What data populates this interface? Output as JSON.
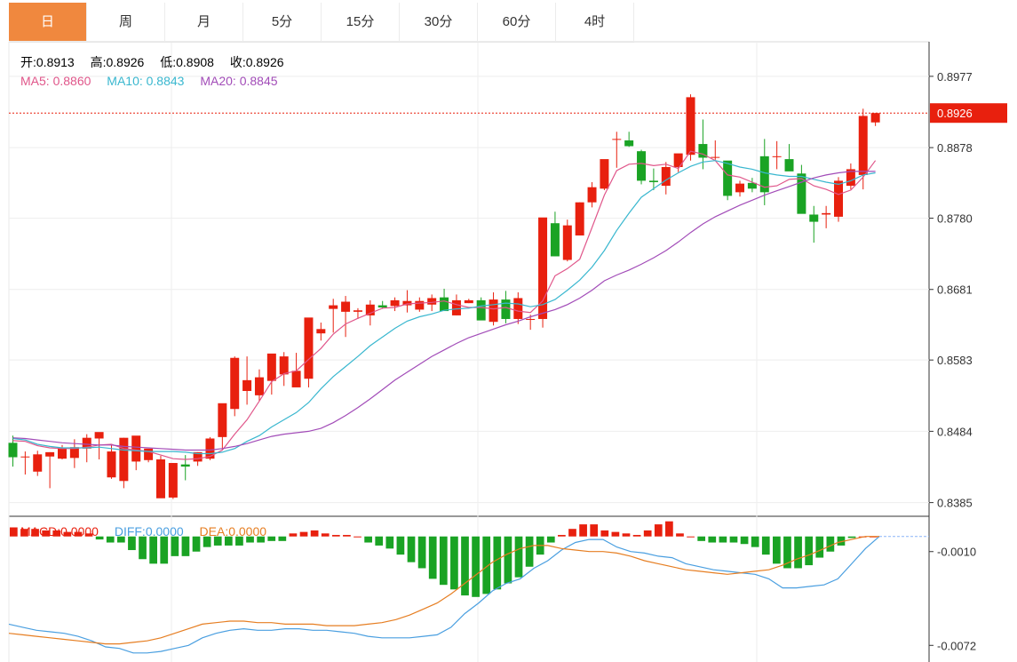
{
  "tabs": [
    {
      "label": "日",
      "active": true
    },
    {
      "label": "周",
      "active": false
    },
    {
      "label": "月",
      "active": false
    },
    {
      "label": "5分",
      "active": false
    },
    {
      "label": "15分",
      "active": false
    },
    {
      "label": "30分",
      "active": false
    },
    {
      "label": "60分",
      "active": false
    },
    {
      "label": "4时",
      "active": false
    }
  ],
  "ohlc_info": {
    "open": "开:0.8913",
    "high": "高:0.8926",
    "low": "低:0.8908",
    "close": "收:0.8926"
  },
  "ma_info": {
    "ma5": "MA5: 0.8860",
    "ma10": "MA10: 0.8843",
    "ma20": "MA20: 0.8845"
  },
  "macd_info": {
    "macd": "MACD:0.0000",
    "diff": "DIFF:0.0000",
    "dea": "DEA:0.0000"
  },
  "colors": {
    "up": "#e8200e",
    "down": "#1aa324",
    "ma5": "#e0568a",
    "ma10": "#39b7cf",
    "ma20": "#a24cb8",
    "diff": "#4a9fe0",
    "dea": "#e67e22",
    "tab_active": "#f0883e"
  },
  "chart_data": {
    "type": "candlestick",
    "price_axis": {
      "ticks": [
        0.8977,
        0.8878,
        0.878,
        0.8681,
        0.8583,
        0.8484,
        0.8385
      ],
      "tick_labels": [
        "0.8977",
        "0.8878",
        "0.8780",
        "0.8681",
        "0.8583",
        "0.8484",
        "0.8385"
      ],
      "range": [
        0.8366,
        0.9025
      ]
    },
    "last_price": 0.8926,
    "last_price_label": "0.8926",
    "candles": [
      [
        0.8468,
        0.8478,
        0.8435,
        0.8448
      ],
      [
        0.8449,
        0.8456,
        0.8424,
        0.8449
      ],
      [
        0.8428,
        0.8457,
        0.8422,
        0.8452
      ],
      [
        0.8449,
        0.8455,
        0.8405,
        0.8455
      ],
      [
        0.8446,
        0.8465,
        0.8445,
        0.846
      ],
      [
        0.8447,
        0.8473,
        0.8433,
        0.8462
      ],
      [
        0.846,
        0.848,
        0.8441,
        0.8475
      ],
      [
        0.8474,
        0.8479,
        0.8445,
        0.8483
      ],
      [
        0.842,
        0.8465,
        0.8418,
        0.8456
      ],
      [
        0.8415,
        0.8475,
        0.8405,
        0.8475
      ],
      [
        0.8442,
        0.8476,
        0.843,
        0.8478
      ],
      [
        0.8444,
        0.8455,
        0.8441,
        0.846
      ],
      [
        0.8391,
        0.845,
        0.8394,
        0.8445
      ],
      [
        0.8392,
        0.844,
        0.839,
        0.844
      ],
      [
        0.8438,
        0.8451,
        0.8416,
        0.8435
      ],
      [
        0.8442,
        0.8455,
        0.8436,
        0.8455
      ],
      [
        0.8446,
        0.8476,
        0.8444,
        0.8474
      ],
      [
        0.8476,
        0.8521,
        0.8458,
        0.8523
      ],
      [
        0.8515,
        0.8588,
        0.8505,
        0.8586
      ],
      [
        0.854,
        0.8588,
        0.8521,
        0.8555
      ],
      [
        0.8534,
        0.857,
        0.8526,
        0.8559
      ],
      [
        0.8554,
        0.859,
        0.8535,
        0.8592
      ],
      [
        0.8563,
        0.8594,
        0.8547,
        0.8588
      ],
      [
        0.8545,
        0.8593,
        0.8548,
        0.8568
      ],
      [
        0.8557,
        0.864,
        0.8545,
        0.8642
      ],
      [
        0.862,
        0.8635,
        0.861,
        0.8626
      ],
      [
        0.8654,
        0.8668,
        0.8621,
        0.8659
      ],
      [
        0.865,
        0.8672,
        0.8615,
        0.8664
      ],
      [
        0.865,
        0.8655,
        0.864,
        0.8652
      ],
      [
        0.8645,
        0.8666,
        0.8631,
        0.866
      ],
      [
        0.8659,
        0.8665,
        0.8654,
        0.8656
      ],
      [
        0.8658,
        0.867,
        0.8651,
        0.8666
      ],
      [
        0.8659,
        0.868,
        0.8649,
        0.8665
      ],
      [
        0.8653,
        0.867,
        0.865,
        0.8665
      ],
      [
        0.866,
        0.8674,
        0.8651,
        0.8669
      ],
      [
        0.867,
        0.8682,
        0.8652,
        0.8651
      ],
      [
        0.8645,
        0.8674,
        0.8645,
        0.8666
      ],
      [
        0.8662,
        0.8668,
        0.8662,
        0.8666
      ],
      [
        0.8666,
        0.867,
        0.8645,
        0.8638
      ],
      [
        0.8636,
        0.8677,
        0.8631,
        0.8667
      ],
      [
        0.8667,
        0.8679,
        0.8634,
        0.864
      ],
      [
        0.864,
        0.8677,
        0.8633,
        0.8669
      ],
      [
        0.864,
        0.8646,
        0.8625,
        0.864
      ],
      [
        0.864,
        0.8689,
        0.8628,
        0.8781
      ],
      [
        0.8773,
        0.8789,
        0.8727,
        0.8727
      ],
      [
        0.8722,
        0.8778,
        0.872,
        0.877
      ],
      [
        0.8756,
        0.8802,
        0.8756,
        0.8802
      ],
      [
        0.8802,
        0.883,
        0.8795,
        0.8823
      ],
      [
        0.8821,
        0.886,
        0.8819,
        0.8862
      ],
      [
        0.889,
        0.89,
        0.885,
        0.889
      ],
      [
        0.8888,
        0.89,
        0.8879,
        0.888
      ],
      [
        0.8873,
        0.8875,
        0.8827,
        0.8832
      ],
      [
        0.8832,
        0.8849,
        0.8819,
        0.883
      ],
      [
        0.8825,
        0.8858,
        0.8813,
        0.8851
      ],
      [
        0.8851,
        0.8868,
        0.8844,
        0.887
      ],
      [
        0.8868,
        0.8952,
        0.886,
        0.8948
      ],
      [
        0.8883,
        0.8917,
        0.8848,
        0.8864
      ],
      [
        0.8865,
        0.8888,
        0.8861,
        0.8865
      ],
      [
        0.886,
        0.8853,
        0.8805,
        0.8811
      ],
      [
        0.8816,
        0.8832,
        0.881,
        0.8828
      ],
      [
        0.8829,
        0.8836,
        0.8816,
        0.8821
      ],
      [
        0.8866,
        0.889,
        0.8798,
        0.8816
      ],
      [
        0.8865,
        0.8887,
        0.8848,
        0.8866
      ],
      [
        0.8862,
        0.8883,
        0.8852,
        0.8845
      ],
      [
        0.8842,
        0.8854,
        0.88,
        0.8786
      ],
      [
        0.8785,
        0.8797,
        0.8746,
        0.8775
      ],
      [
        0.8785,
        0.8797,
        0.8766,
        0.8787
      ],
      [
        0.8782,
        0.8837,
        0.8775,
        0.8832
      ],
      [
        0.8825,
        0.8856,
        0.882,
        0.8848
      ],
      [
        0.884,
        0.8932,
        0.882,
        0.8922
      ],
      [
        0.8913,
        0.8926,
        0.8908,
        0.8926
      ]
    ],
    "ma5": [
      0.8471,
      0.847,
      0.8464,
      0.8461,
      0.846,
      0.846,
      0.8462,
      0.8465,
      0.8466,
      0.846,
      0.8458,
      0.8456,
      0.8451,
      0.8446,
      0.8445,
      0.8446,
      0.8449,
      0.8458,
      0.848,
      0.85,
      0.8526,
      0.8553,
      0.8564,
      0.8568,
      0.8584,
      0.8599,
      0.8619,
      0.8633,
      0.8641,
      0.8648,
      0.8655,
      0.8656,
      0.8661,
      0.8662,
      0.8663,
      0.8665,
      0.866,
      0.8656,
      0.8656,
      0.8654,
      0.8656,
      0.8651,
      0.8649,
      0.8665,
      0.87,
      0.871,
      0.8723,
      0.8767,
      0.8812,
      0.8846,
      0.8855,
      0.8856,
      0.8853,
      0.8855,
      0.8849,
      0.8873,
      0.8869,
      0.886,
      0.884,
      0.8837,
      0.883,
      0.8823,
      0.8825,
      0.8834,
      0.8835,
      0.8825,
      0.882,
      0.8813,
      0.8819,
      0.8837,
      0.886
    ],
    "ma10": [
      0.8474,
      0.8472,
      0.8466,
      0.8463,
      0.8461,
      0.8461,
      0.8461,
      0.8462,
      0.846,
      0.8458,
      0.8457,
      0.8456,
      0.8456,
      0.8456,
      0.8455,
      0.8453,
      0.8453,
      0.8455,
      0.846,
      0.847,
      0.8478,
      0.849,
      0.85,
      0.851,
      0.8524,
      0.8543,
      0.856,
      0.8574,
      0.8588,
      0.8603,
      0.8615,
      0.8627,
      0.8637,
      0.8643,
      0.8647,
      0.8652,
      0.8654,
      0.8655,
      0.8658,
      0.866,
      0.8662,
      0.8661,
      0.8657,
      0.866,
      0.8667,
      0.868,
      0.8694,
      0.8712,
      0.8735,
      0.8763,
      0.8787,
      0.8809,
      0.8821,
      0.8833,
      0.8843,
      0.8852,
      0.8858,
      0.886,
      0.8856,
      0.8851,
      0.8848,
      0.8843,
      0.884,
      0.8838,
      0.8838,
      0.8834,
      0.883,
      0.8827,
      0.8832,
      0.884,
      0.8843
    ],
    "ma20": [
      0.8475,
      0.8474,
      0.8472,
      0.847,
      0.8468,
      0.8467,
      0.8466,
      0.8465,
      0.8465,
      0.8463,
      0.8462,
      0.8461,
      0.846,
      0.8459,
      0.8458,
      0.8458,
      0.8458,
      0.846,
      0.8463,
      0.8467,
      0.8472,
      0.8477,
      0.848,
      0.8482,
      0.8484,
      0.8488,
      0.8496,
      0.8506,
      0.8517,
      0.8529,
      0.8542,
      0.8555,
      0.8566,
      0.8577,
      0.8588,
      0.8597,
      0.8606,
      0.8614,
      0.862,
      0.8626,
      0.8632,
      0.8637,
      0.8643,
      0.8648,
      0.8653,
      0.866,
      0.8669,
      0.868,
      0.8693,
      0.8701,
      0.8708,
      0.8716,
      0.8725,
      0.8735,
      0.8747,
      0.876,
      0.8772,
      0.8782,
      0.879,
      0.8798,
      0.8805,
      0.8812,
      0.8818,
      0.8824,
      0.883,
      0.8836,
      0.884,
      0.8843,
      0.8845,
      0.8845,
      0.8845
    ]
  },
  "macd_chart": {
    "axis": {
      "ticks": [
        -0.001,
        -0.0072
      ],
      "tick_labels": [
        "-0.0010",
        "-0.0072"
      ],
      "range": [
        -0.0083,
        0.0011
      ]
    },
    "zero_line": 0.0,
    "hist": [
      0.0006,
      0.0005,
      0.0005,
      0.0004,
      0.0004,
      0.0003,
      0.0003,
      0.0002,
      -0.0002,
      -0.0004,
      -0.0004,
      -0.0009,
      -0.0015,
      -0.0018,
      -0.0018,
      -0.0013,
      -0.0013,
      -0.001,
      -0.0007,
      -0.0006,
      -0.0006,
      -0.0006,
      -0.0004,
      -0.0004,
      -0.0003,
      -0.0003,
      0.0002,
      0.0003,
      0.0004,
      0.0002,
      0.0001,
      0.0001,
      0.0,
      -0.0004,
      -0.0006,
      -0.0008,
      -0.0012,
      -0.0017,
      -0.0021,
      -0.0028,
      -0.0032,
      -0.0035,
      -0.0039,
      -0.004,
      -0.0038,
      -0.0035,
      -0.0031,
      -0.0027,
      -0.002,
      -0.0012,
      -0.0004,
      0.0001,
      0.0005,
      0.0008,
      0.0008,
      0.0004,
      0.0003,
      0.0002,
      0.0001,
      0.0004,
      0.0008,
      0.001,
      0.0002,
      0.0,
      -0.0003,
      -0.0004,
      -0.0004,
      -0.0004,
      -0.0005,
      -0.0007,
      -0.0012,
      -0.0018,
      -0.0021,
      -0.0021,
      -0.0019,
      -0.0014,
      -0.001,
      -0.0006,
      -0.0001,
      0.0,
      0.0
    ],
    "diff": [
      -0.0058,
      -0.006,
      -0.0062,
      -0.0063,
      -0.0064,
      -0.0066,
      -0.0069,
      -0.0073,
      -0.0074,
      -0.0077,
      -0.0077,
      -0.0076,
      -0.0074,
      -0.0072,
      -0.0067,
      -0.0064,
      -0.0062,
      -0.0061,
      -0.0062,
      -0.0062,
      -0.0061,
      -0.0061,
      -0.0062,
      -0.0062,
      -0.0063,
      -0.0064,
      -0.0066,
      -0.0067,
      -0.0067,
      -0.0067,
      -0.0066,
      -0.0065,
      -0.006,
      -0.0051,
      -0.0044,
      -0.0036,
      -0.0031,
      -0.0028,
      -0.0021,
      -0.0016,
      -0.0009,
      -0.0004,
      -0.0002,
      -0.0002,
      -0.0007,
      -0.001,
      -0.0011,
      -0.0013,
      -0.0014,
      -0.0018,
      -0.002,
      -0.0022,
      -0.0023,
      -0.0024,
      -0.0025,
      -0.0028,
      -0.0034,
      -0.0034,
      -0.0033,
      -0.0032,
      -0.0028,
      -0.0018,
      -0.0008,
      0.0
    ],
    "dea": [
      -0.0064,
      -0.0065,
      -0.0066,
      -0.0067,
      -0.0068,
      -0.0069,
      -0.007,
      -0.0071,
      -0.0071,
      -0.007,
      -0.0069,
      -0.0067,
      -0.0064,
      -0.0061,
      -0.0058,
      -0.0057,
      -0.0056,
      -0.0056,
      -0.0057,
      -0.0057,
      -0.0058,
      -0.0058,
      -0.0058,
      -0.0059,
      -0.0059,
      -0.0059,
      -0.0058,
      -0.0057,
      -0.0055,
      -0.0052,
      -0.0048,
      -0.0044,
      -0.0038,
      -0.0031,
      -0.0024,
      -0.0017,
      -0.0012,
      -0.0008,
      -0.0006,
      -0.0006,
      -0.0008,
      -0.0009,
      -0.001,
      -0.001,
      -0.0011,
      -0.0013,
      -0.0016,
      -0.0018,
      -0.002,
      -0.0022,
      -0.0023,
      -0.0024,
      -0.0025,
      -0.0024,
      -0.0023,
      -0.0022,
      -0.0019,
      -0.0015,
      -0.0012,
      -0.0008,
      -0.0004,
      -0.0002,
      0.0,
      0.0
    ]
  }
}
